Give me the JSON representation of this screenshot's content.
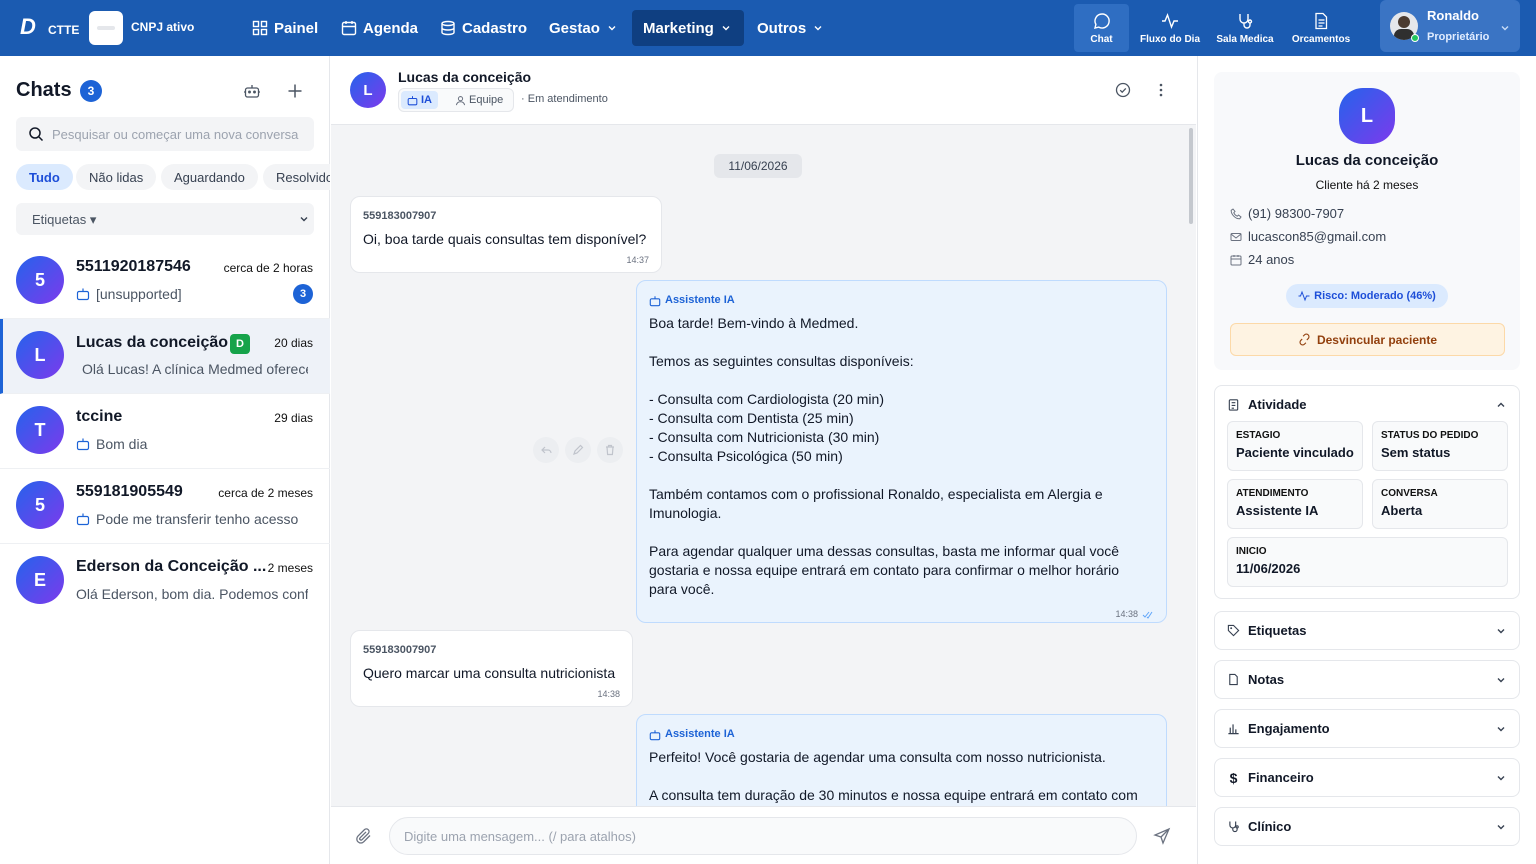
{
  "topbar": {
    "logo_big": "D",
    "logo_small": "CTTE",
    "cnpj_status": "CNPJ ativo",
    "nav": [
      {
        "label": "Painel",
        "icon": "grid-icon"
      },
      {
        "label": "Agenda",
        "icon": "calendar-icon"
      },
      {
        "label": "Cadastro",
        "icon": "database-icon"
      },
      {
        "label": "Gestao",
        "icon": "chevron-down-icon"
      },
      {
        "label": "Marketing",
        "icon": "chevron-down-icon"
      },
      {
        "label": "Outros",
        "icon": "chevron-down-icon"
      }
    ],
    "tools": [
      {
        "label": "Chat",
        "icon": "chat-bubble-icon"
      },
      {
        "label": "Fluxo do Dia",
        "icon": "activity-icon"
      },
      {
        "label": "Sala Medica",
        "icon": "stethoscope-icon"
      },
      {
        "label": "Orcamentos",
        "icon": "document-icon"
      }
    ],
    "user": {
      "name": "Ronaldo",
      "role": "Proprietário"
    }
  },
  "chats": {
    "title": "Chats",
    "count": "3",
    "search_placeholder": "Pesquisar ou começar uma nova conversa",
    "filters": [
      "Tudo",
      "Não lidas",
      "Aguardando",
      "Resolvido"
    ],
    "tags_label": "Etiquetas ▾",
    "list": [
      {
        "initial": "5",
        "name": "5511920187546",
        "time": "cerca de 2 horas",
        "preview": "[unsupported]",
        "badge": "3"
      },
      {
        "initial": "L",
        "name": "Lucas da conceição",
        "tag": "D",
        "time": "20 dias",
        "preview": "Olá Lucas! A clínica Medmed oferece"
      },
      {
        "initial": "T",
        "name": "tccine",
        "time": "29 dias",
        "preview": "Bom dia"
      },
      {
        "initial": "5",
        "name": "559181905549",
        "time": "cerca de 2 meses",
        "preview": "Pode me transferir tenho acesso"
      },
      {
        "initial": "E",
        "name": "Ederson da Conceição ...",
        "time": "2 meses",
        "preview": "Olá Ederson, bom dia. Podemos confirmar"
      }
    ]
  },
  "conversation": {
    "initial": "L",
    "name": "Lucas da conceição",
    "mode_ia": "IA",
    "mode_team": "Equipe",
    "status": "Em atendimento",
    "date_chip": "11/06/2026",
    "messages": [
      {
        "sender": "559183007907",
        "text": "Oi, boa tarde quais consultas tem disponível?",
        "time": "14:37"
      },
      {
        "sender": "Assistente IA",
        "lines": [
          "Boa tarde! Bem-vindo à Medmed.",
          "",
          "Temos as seguintes consultas disponíveis:",
          "",
          "- Consulta com Cardiologista (20 min)",
          "- Consulta com Dentista (25 min)",
          "- Consulta com Nutricionista (30 min)",
          "- Consulta Psicológica (50 min)",
          "",
          "Também contamos com o profissional Ronaldo, especialista em Alergia e",
          "Imunologia.",
          "",
          "Para agendar qualquer uma dessas consultas, basta me informar qual você",
          "gostaria e nossa equipe entrará em contato para confirmar o melhor horário",
          "para você."
        ],
        "time": "14:38"
      },
      {
        "sender": "559183007907",
        "text": "Quero marcar uma consulta nutricionista",
        "time": "14:38"
      },
      {
        "sender": "Assistente IA",
        "lines": [
          "Perfeito! Você gostaria de agendar uma consulta com nosso nutricionista.",
          "",
          "A consulta tem duração de 30 minutos e nossa equipe entrará em contato com"
        ]
      }
    ],
    "composer_placeholder": "Digite uma mensagem... (/ para atalhos)"
  },
  "profile": {
    "initial": "L",
    "name": "Lucas da conceição",
    "since": "Cliente há 2 meses",
    "phone": "(91) 98300-7907",
    "email": "lucascon85@gmail.com",
    "age": "24 anos",
    "risk": "Risco: Moderado (46%)",
    "unlink": "Desvincular paciente",
    "activity_title": "Atividade",
    "tiles": [
      {
        "key": "ESTAGIO",
        "value": "Paciente vinculado"
      },
      {
        "key": "STATUS DO PEDIDO",
        "value": "Sem status"
      },
      {
        "key": "ATENDIMENTO",
        "value": "Assistente IA"
      },
      {
        "key": "CONVERSA",
        "value": "Aberta"
      },
      {
        "key": "INICIO",
        "value": "11/06/2026"
      }
    ],
    "sections": [
      "Etiquetas",
      "Notas",
      "Engajamento",
      "Financeiro",
      "Clínico"
    ]
  },
  "colors": {
    "topbar": "#1b5bb1",
    "accent": "#1d63d6",
    "ai_bubble": "#eaf3fd"
  }
}
